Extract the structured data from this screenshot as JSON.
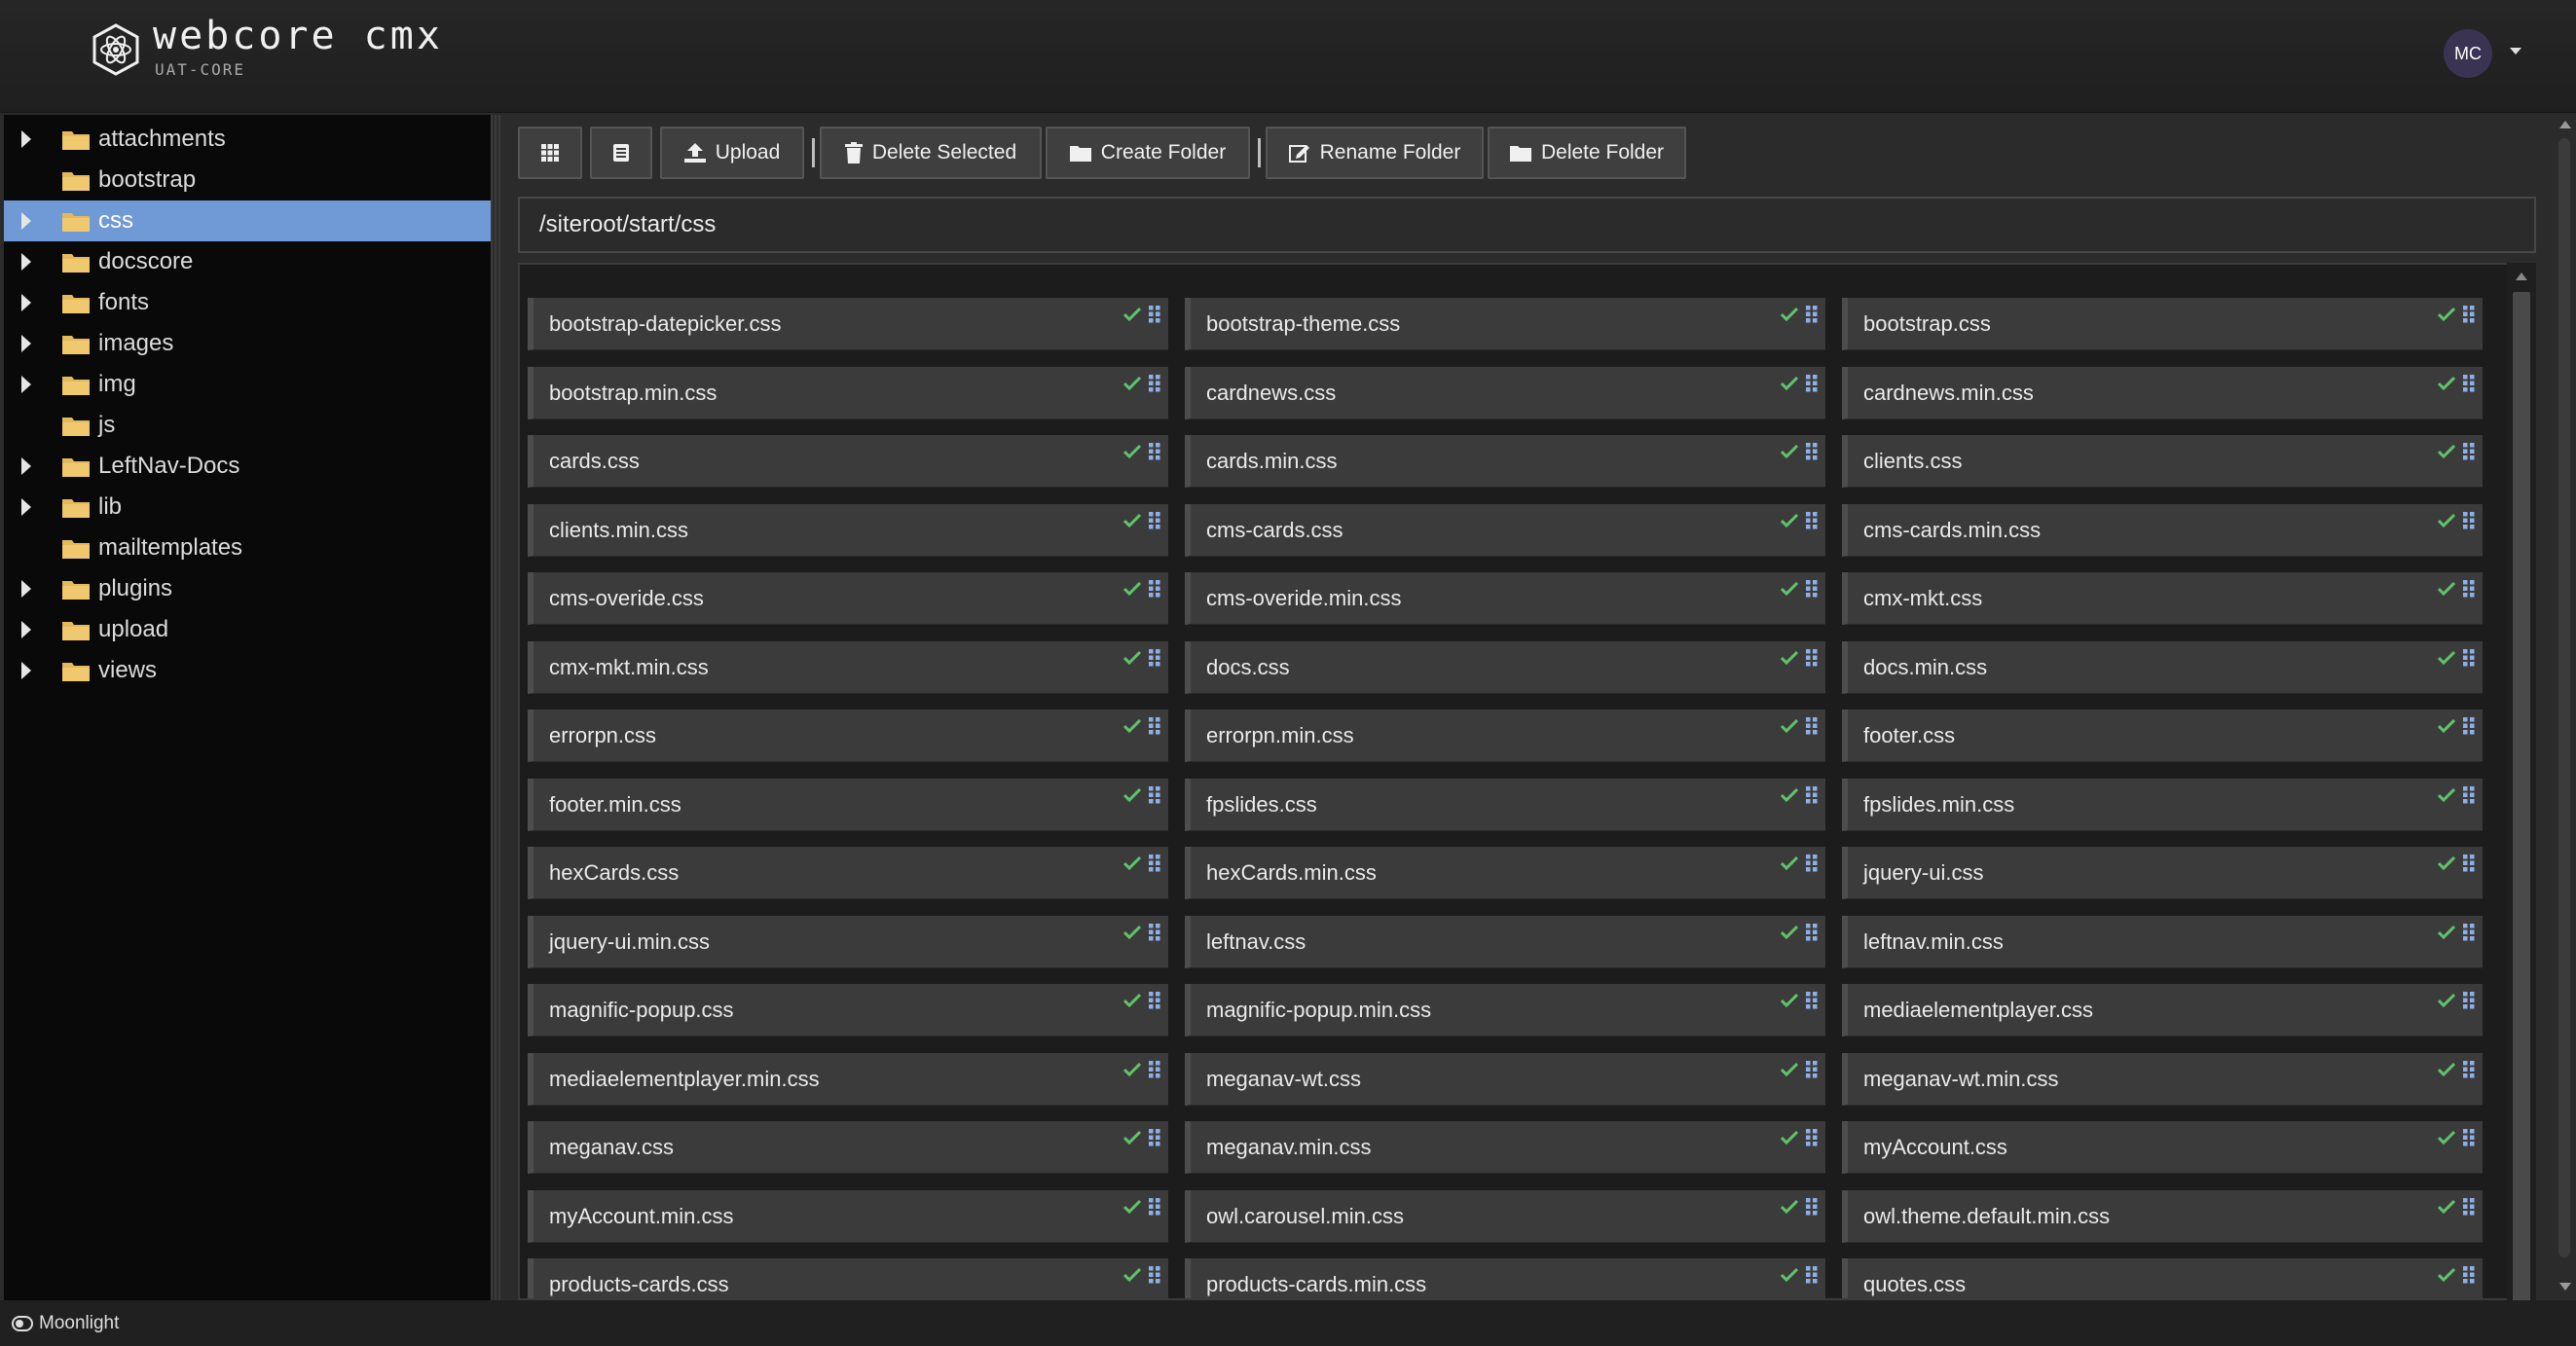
{
  "header": {
    "brand_name": "webcore cmx",
    "brand_sub": "UAT-CORE",
    "user_initials": "MC"
  },
  "sidebar": {
    "items": [
      {
        "label": "attachments",
        "expandable": true,
        "selected": false
      },
      {
        "label": "bootstrap",
        "expandable": false,
        "selected": false
      },
      {
        "label": "css",
        "expandable": true,
        "selected": true
      },
      {
        "label": "docscore",
        "expandable": true,
        "selected": false
      },
      {
        "label": "fonts",
        "expandable": true,
        "selected": false
      },
      {
        "label": "images",
        "expandable": true,
        "selected": false
      },
      {
        "label": "img",
        "expandable": true,
        "selected": false
      },
      {
        "label": "js",
        "expandable": false,
        "selected": false
      },
      {
        "label": "LeftNav-Docs",
        "expandable": true,
        "selected": false
      },
      {
        "label": "lib",
        "expandable": true,
        "selected": false
      },
      {
        "label": "mailtemplates",
        "expandable": false,
        "selected": false
      },
      {
        "label": "plugins",
        "expandable": true,
        "selected": false
      },
      {
        "label": "upload",
        "expandable": true,
        "selected": false
      },
      {
        "label": "views",
        "expandable": true,
        "selected": false
      }
    ]
  },
  "toolbar": {
    "upload_label": "Upload",
    "delete_selected_label": "Delete Selected",
    "create_folder_label": "Create Folder",
    "rename_folder_label": "Rename Folder",
    "delete_folder_label": "Delete Folder"
  },
  "path": "/siteroot/start/css",
  "files": [
    "bootstrap-datepicker.css",
    "bootstrap-theme.css",
    "bootstrap.css",
    "bootstrap.min.css",
    "cardnews.css",
    "cardnews.min.css",
    "cards.css",
    "cards.min.css",
    "clients.css",
    "clients.min.css",
    "cms-cards.css",
    "cms-cards.min.css",
    "cms-overide.css",
    "cms-overide.min.css",
    "cmx-mkt.css",
    "cmx-mkt.min.css",
    "docs.css",
    "docs.min.css",
    "errorpn.css",
    "errorpn.min.css",
    "footer.css",
    "footer.min.css",
    "fpslides.css",
    "fpslides.min.css",
    "hexCards.css",
    "hexCards.min.css",
    "jquery-ui.css",
    "jquery-ui.min.css",
    "leftnav.css",
    "leftnav.min.css",
    "magnific-popup.css",
    "magnific-popup.min.css",
    "mediaelementplayer.css",
    "mediaelementplayer.min.css",
    "meganav-wt.css",
    "meganav-wt.min.css",
    "meganav.css",
    "meganav.min.css",
    "myAccount.css",
    "myAccount.min.css",
    "owl.carousel.min.css",
    "owl.theme.default.min.css",
    "products-cards.css",
    "products-cards.min.css",
    "quotes.css"
  ],
  "statusbar": {
    "theme_label": "Moonlight"
  },
  "colors": {
    "selected_bg": "#6f9ad6",
    "check": "#5fc36a",
    "grip": "#8fb0e6",
    "folder": "#e3b95b"
  },
  "icons": {
    "grid_view": "grid-view-icon",
    "list_view": "list-view-icon",
    "upload": "upload-icon",
    "trash": "trash-icon",
    "folder": "folder-icon",
    "edit": "edit-icon",
    "check": "check-icon",
    "grip": "drag-handle-icon",
    "moon": "moon-icon"
  }
}
